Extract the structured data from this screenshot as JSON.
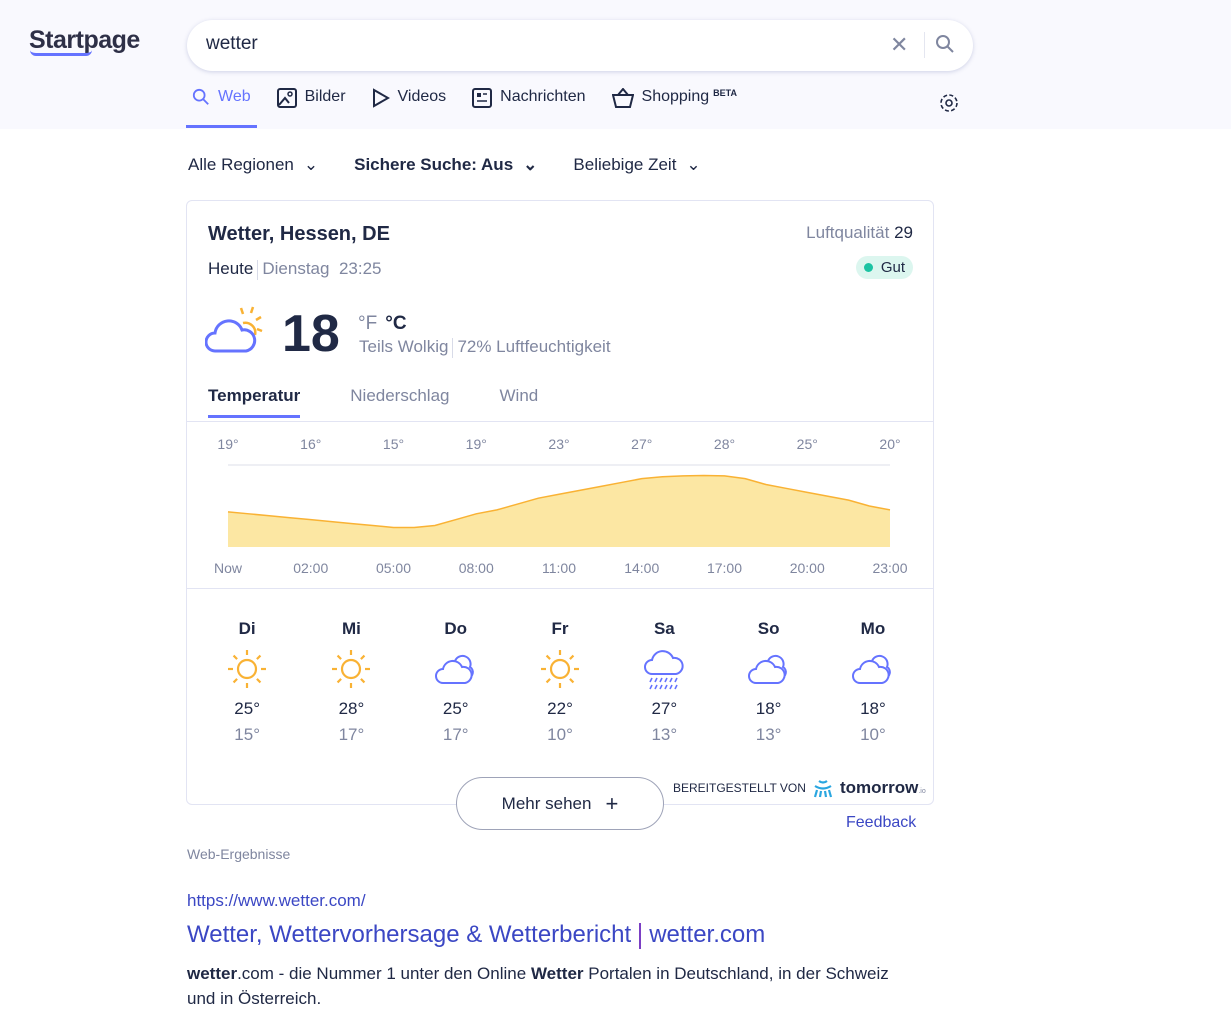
{
  "header": {
    "logo": "Startpage",
    "query": "wetter",
    "tabs": [
      {
        "label": "Web",
        "icon": "search-icon"
      },
      {
        "label": "Bilder",
        "icon": "image-icon"
      },
      {
        "label": "Videos",
        "icon": "play-icon"
      },
      {
        "label": "Nachrichten",
        "icon": "news-icon"
      },
      {
        "label": "Shopping",
        "sup": "BETA",
        "icon": "basket-icon"
      }
    ]
  },
  "filters": {
    "region": "Alle Regionen",
    "safe": "Sichere Suche: Aus",
    "time": "Beliebige Zeit"
  },
  "weather": {
    "location": "Wetter, Hessen, DE",
    "today": "Heute",
    "day": "Dienstag",
    "time": "23:25",
    "aq_label": "Luftqualität",
    "aq_value": "29",
    "aq_status": "Gut",
    "aq_color": "#1cc3a3",
    "temp": "18",
    "unit_f": "°F",
    "unit_c": "°C",
    "condition": "Teils Wolkig",
    "humidity": "72% Luftfeuchtigkeit",
    "tabs": [
      "Temperatur",
      "Niederschlag",
      "Wind"
    ],
    "days": [
      {
        "name": "Di",
        "icon": "sun",
        "hi": "25°",
        "lo": "15°"
      },
      {
        "name": "Mi",
        "icon": "sun",
        "hi": "28°",
        "lo": "17°"
      },
      {
        "name": "Do",
        "icon": "cloud",
        "hi": "25°",
        "lo": "17°"
      },
      {
        "name": "Fr",
        "icon": "sun",
        "hi": "22°",
        "lo": "10°"
      },
      {
        "name": "Sa",
        "icon": "rain",
        "hi": "27°",
        "lo": "13°"
      },
      {
        "name": "So",
        "icon": "cloud",
        "hi": "18°",
        "lo": "13°"
      },
      {
        "name": "Mo",
        "icon": "cloud",
        "hi": "18°",
        "lo": "10°"
      }
    ],
    "more": "Mehr sehen",
    "powered": "BEREITGESTELLT VON",
    "provider": "tomorrow",
    "provider_suffix": ".io",
    "feedback": "Feedback"
  },
  "chart_data": {
    "type": "area",
    "x": [
      "Now",
      "02:00",
      "05:00",
      "08:00",
      "11:00",
      "14:00",
      "17:00",
      "20:00",
      "23:00"
    ],
    "values": [
      19,
      16,
      15,
      19,
      23,
      27,
      28,
      25,
      20
    ],
    "curve": [
      19,
      18.5,
      18,
      17.5,
      17,
      16.5,
      16,
      15.5,
      15,
      15,
      15.5,
      17,
      18.5,
      19.5,
      21,
      22.5,
      23.5,
      24.5,
      25.5,
      26.5,
      27.5,
      28,
      28.2,
      28.3,
      28.2,
      27.5,
      26,
      25,
      24,
      23,
      22,
      20.5,
      19.5
    ],
    "ylim": [
      10,
      31
    ],
    "color": "#f9b234",
    "fill": "#fce7a3"
  },
  "results": {
    "section": "Web-Ergebnisse",
    "url": "https://www.wetter.com/",
    "title_a": "Wetter, Wettervorhersage & Wetterbericht",
    "title_b": "wetter.com",
    "desc": [
      {
        "b": "wetter"
      },
      {
        "t": ".com - die Nummer 1 unter den Online "
      },
      {
        "b": "Wetter"
      },
      {
        "t": " Portalen in Deutschland, in der Schweiz und in Österreich."
      }
    ]
  }
}
